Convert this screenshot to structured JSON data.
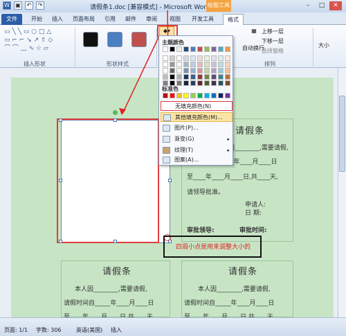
{
  "window": {
    "title": "请假条1.doc [兼容模式] - Microsoft Word",
    "context_tab": "绘图工具"
  },
  "tabs": [
    "文件",
    "开始",
    "插入",
    "页面布局",
    "引用",
    "邮件",
    "审阅",
    "视图",
    "开发工具",
    "格式"
  ],
  "ribbon": {
    "groups": [
      "插入形状",
      "形状样式",
      "排列"
    ],
    "arrange_items": [
      "上移一层",
      "下移一层",
      "选择窗格",
      "自动换行"
    ],
    "size_label": "大小",
    "shape_styles": [
      {
        "color": "#111111"
      },
      {
        "color": "#4a7fc1"
      },
      {
        "color": "#c0504d"
      }
    ]
  },
  "fill_menu": {
    "theme_colors_label": "主题颜色",
    "standard_colors_label": "标准色",
    "no_fill": "无填充颜色(N)",
    "more_colors": "其他填充颜色(M)...",
    "picture": "图片(P)...",
    "gradient": "渐变(G)",
    "texture": "纹理(T)",
    "pattern": "图案(A)...",
    "theme_top": [
      "#ffffff",
      "#000000",
      "#eeece1",
      "#1f497d",
      "#4f81bd",
      "#c0504d",
      "#9bbb59",
      "#8064a2",
      "#4bacc6",
      "#f79646"
    ],
    "standard": [
      "#c00000",
      "#ff0000",
      "#ffc000",
      "#ffff00",
      "#92d050",
      "#00b050",
      "#00b0f0",
      "#0070c0",
      "#002060",
      "#7030a0"
    ]
  },
  "document": {
    "card_title": "请假条",
    "line1": "本人因________,需要请假,",
    "line2": "请假时间自_____年____月____日",
    "line3": "至____年____月____日,共____天,",
    "line4": "请领导批准。",
    "applicant": "申请人:",
    "date": "日  期:",
    "approver": "审批领导:",
    "approve_time": "审批时间:",
    "annotation": "四周小点是用来调整大小的"
  },
  "status": {
    "page": "页面: 1/1",
    "words": "字数: 306",
    "lang": "英语(美国)",
    "mode": "插入"
  }
}
